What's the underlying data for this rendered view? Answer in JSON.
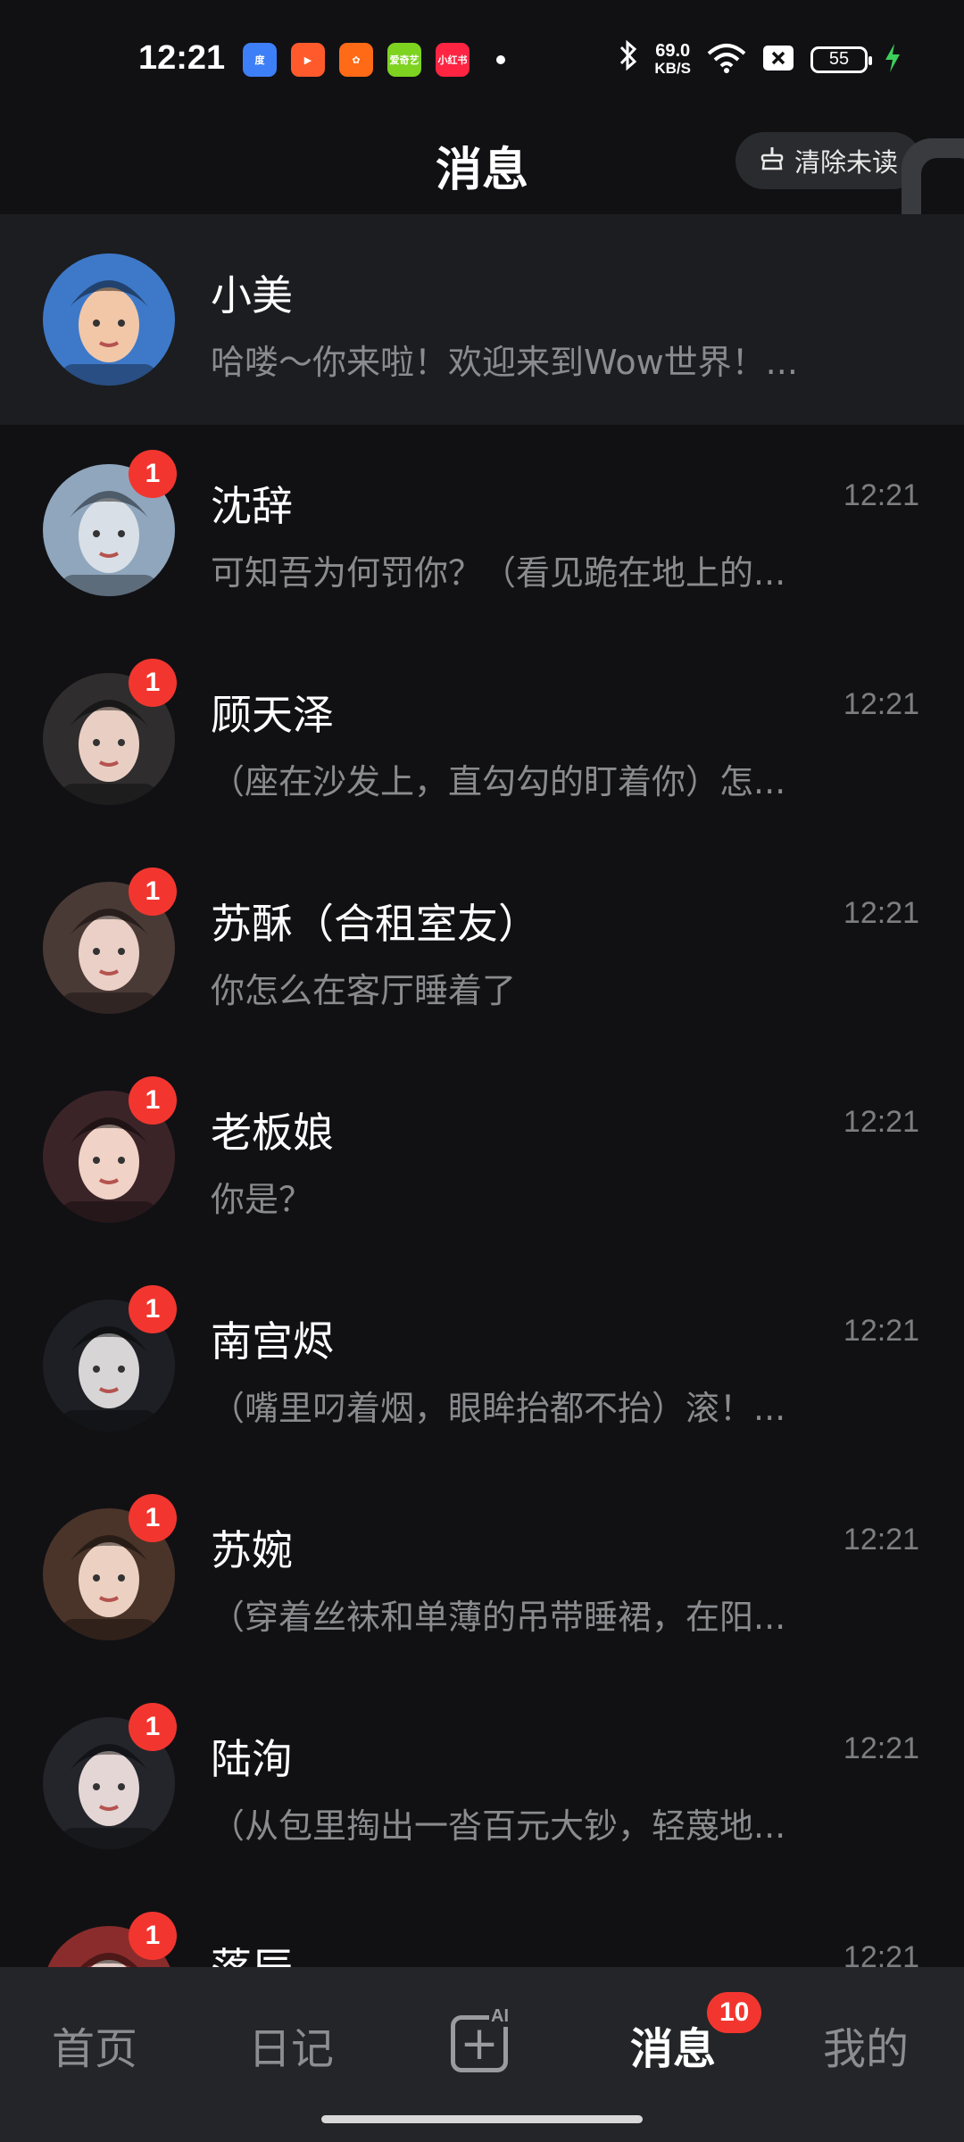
{
  "status_bar": {
    "time": "12:21",
    "net_speed_value": "69.0",
    "net_speed_unit": "KB/S",
    "battery": "55",
    "app_icons": [
      {
        "name": "baidu-icon",
        "color": "#3d7ff6",
        "text": "度"
      },
      {
        "name": "video-play-icon",
        "color": "#ff5a2c",
        "text": "▶"
      },
      {
        "name": "kuaishou-icon",
        "color": "#ff6a16",
        "text": "✿"
      },
      {
        "name": "iqiyi-icon",
        "color": "#7ed321",
        "text": "爱奇艺"
      },
      {
        "name": "xiaohongshu-icon",
        "color": "#ff2442",
        "text": "小红书"
      }
    ]
  },
  "header": {
    "title": "消息",
    "clear_unread_label": "清除未读"
  },
  "conversations": [
    {
      "name": "小美",
      "preview": "哈喽～你来啦！欢迎来到Wow世界！...",
      "time": "",
      "unread": "",
      "pinned": true,
      "avatar": {
        "bg": "#3e79c9",
        "face": "#f1c7a8"
      }
    },
    {
      "name": "沈辞",
      "preview": "可知吾为何罚你？（看见跪在地上的...",
      "time": "12:21",
      "unread": "1",
      "avatar": {
        "bg": "#8fa6bd",
        "face": "#d9dfe6"
      }
    },
    {
      "name": "顾天泽",
      "preview": "（座在沙发上，直勾勾的盯着你）怎...",
      "time": "12:21",
      "unread": "1",
      "avatar": {
        "bg": "#2f2d2e",
        "face": "#e9cfc3"
      }
    },
    {
      "name": "苏酥（合租室友）",
      "preview": "你怎么在客厅睡着了",
      "time": "12:21",
      "unread": "1",
      "avatar": {
        "bg": "#4a3a36",
        "face": "#ead0c6"
      }
    },
    {
      "name": "老板娘",
      "preview": "你是？",
      "time": "12:21",
      "unread": "1",
      "avatar": {
        "bg": "#3b2428",
        "face": "#f0d2c6"
      }
    },
    {
      "name": "南宫烬",
      "preview": "（嘴里叼着烟，眼眸抬都不抬）滚！...",
      "time": "12:21",
      "unread": "1",
      "avatar": {
        "bg": "#1e1f24",
        "face": "#d8d5d6"
      }
    },
    {
      "name": "苏婉",
      "preview": "（穿着丝袜和单薄的吊带睡裙，在阳...",
      "time": "12:21",
      "unread": "1",
      "avatar": {
        "bg": "#4a3429",
        "face": "#ecd1c2"
      }
    },
    {
      "name": "陆洵",
      "preview": "（从包里掏出一沓百元大钞，轻蔑地...",
      "time": "12:21",
      "unread": "1",
      "avatar": {
        "bg": "#24252b",
        "face": "#e3d6d4"
      }
    },
    {
      "name": "落辰",
      "preview": "",
      "time": "12:21",
      "unread": "1",
      "avatar": {
        "bg": "#8a2c2c",
        "face": "#e6cfc8"
      }
    }
  ],
  "bottom_nav": {
    "home": "首页",
    "diary": "日记",
    "create_tag": "AI",
    "messages": "消息",
    "messages_badge": "10",
    "mine": "我的"
  }
}
